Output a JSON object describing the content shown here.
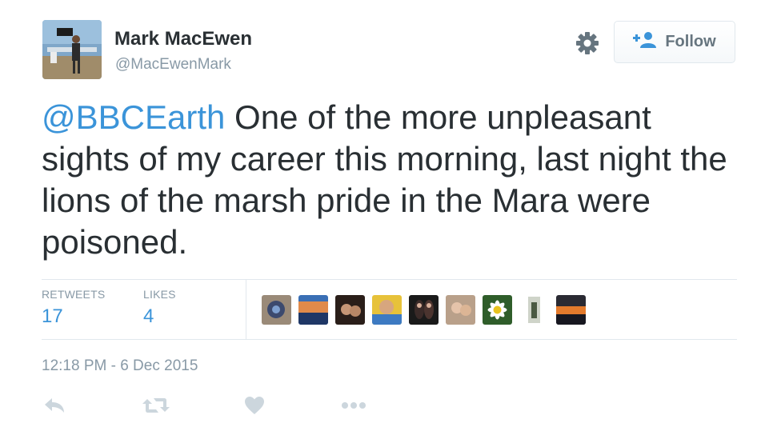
{
  "user": {
    "display_name": "Mark MacEwen",
    "handle": "@MacEwenMark"
  },
  "header": {
    "follow_label": "Follow",
    "gear_icon": "gear-icon",
    "follow_icon": "add-user-icon"
  },
  "tweet": {
    "mention": "@BBCEarth",
    "text": " One of the more unpleasant sights of my career this morning, last night the lions of the marsh pride in the Mara were poisoned."
  },
  "stats": {
    "retweets_label": "RETWEETS",
    "retweets_value": "17",
    "likes_label": "LIKES",
    "likes_value": "4"
  },
  "timestamp": "12:18 PM - 6 Dec 2015",
  "actions": {
    "reply_icon": "reply-icon",
    "retweet_icon": "retweet-icon",
    "like_icon": "heart-icon",
    "more_icon": "more-icon"
  },
  "colors": {
    "link": "#3b94d9",
    "muted": "#8899a6",
    "text": "#292f33",
    "border": "#e1e8ed",
    "icon": "#ccd6dd"
  }
}
